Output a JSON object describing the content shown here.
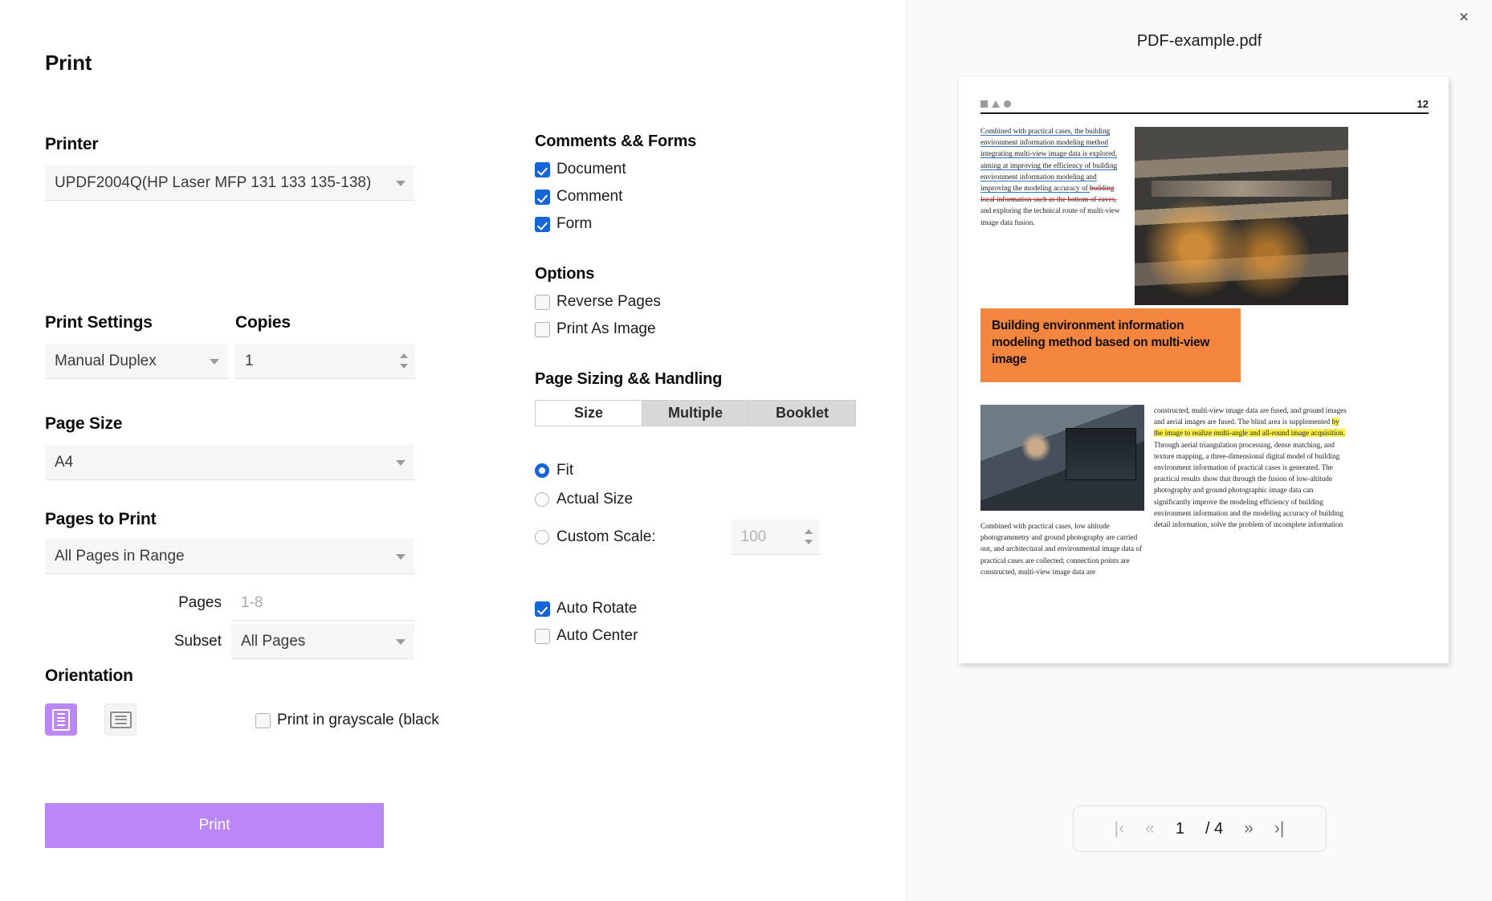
{
  "dialog": {
    "title": "Print"
  },
  "printer": {
    "label": "Printer",
    "value": "UPDF2004Q(HP Laser MFP 131 133 135-138)"
  },
  "print_settings": {
    "label": "Print Settings",
    "value": "Manual Duplex"
  },
  "copies": {
    "label": "Copies",
    "value": "1"
  },
  "page_size": {
    "label": "Page Size",
    "value": "A4"
  },
  "pages_to_print": {
    "label": "Pages to Print",
    "value": "All Pages in Range",
    "pages_label": "Pages",
    "pages_placeholder": "1-8",
    "subset_label": "Subset",
    "subset_value": "All Pages"
  },
  "orientation": {
    "label": "Orientation",
    "portrait_name": "portrait",
    "landscape_name": "landscape",
    "selected": "portrait",
    "grayscale_label": "Print in grayscale (black",
    "grayscale_checked": false
  },
  "comments_forms": {
    "title": "Comments && Forms",
    "items": [
      {
        "label": "Document",
        "checked": true
      },
      {
        "label": "Comment",
        "checked": true
      },
      {
        "label": "Form",
        "checked": true
      }
    ]
  },
  "options": {
    "title": "Options",
    "items": [
      {
        "label": "Reverse Pages",
        "checked": false
      },
      {
        "label": "Print As Image",
        "checked": false
      }
    ]
  },
  "page_sizing": {
    "title": "Page Sizing && Handling",
    "tabs": [
      {
        "label": "Size",
        "active": true
      },
      {
        "label": "Multiple",
        "active": false
      },
      {
        "label": "Booklet",
        "active": false
      }
    ],
    "scale_options": [
      {
        "label": "Fit",
        "selected": true
      },
      {
        "label": "Actual Size",
        "selected": false
      },
      {
        "label": "Custom Scale:",
        "selected": false
      }
    ],
    "custom_scale_value": "100",
    "extra": [
      {
        "label": "Auto Rotate",
        "checked": true
      },
      {
        "label": "Auto Center",
        "checked": false
      }
    ]
  },
  "print_button": {
    "label": "Print"
  },
  "preview": {
    "file_name": "PDF-example.pdf",
    "close_icon": "×",
    "page_number_badge": "12",
    "document": {
      "col1_paragraph": "Combined with practical cases, the building environment information modeling method integrating multi-view image data is explored, aiming at improving the efficiency of building environment information modeling and improving the modeling accuracy of ",
      "col1_struck": "building local information such as the bottom of eaves,",
      "col1_tail": " and exploring the technical route of multi-view image data fusion.",
      "banner_title": "Building environment information modeling method based on multi-view image",
      "col2_lead": "constructed, multi-view image data are fused, and ground images and aerial images are fused. The blind area is supplemented ",
      "col2_highlight": "by the image to realize multi-angle and all-round image acquisition.",
      "col2_tail": " Through aerial triangulation processing, dense matching, and texture mapping, a three-dimensional digital model of building environment information of practical cases is generated. The practical results show that through the fusion of low-altitude photography and ground photographic image data can significantly improve the modeling efficiency of building environment information and the modeling accuracy of building detail information, solve the problem of incomplete information",
      "col3_paragraph": "Combined with practical cases, low altitude photogrammetry and ground photography are carried out, and architectural and environmental image data of practical cases are collected; connection points are constructed, multi-view image data are"
    },
    "pager": {
      "first": "|‹",
      "prev": "«",
      "current": "1",
      "total": "/ 4",
      "next": "»",
      "last": "›|"
    }
  },
  "colors": {
    "accent_purple": "#bb86f5",
    "checkbox_blue": "#1565d8",
    "banner_orange": "#f5863f",
    "highlight_yellow": "#fbf14a",
    "underline_blue": "#2f6fd0",
    "strike_red": "#e02a2a"
  }
}
